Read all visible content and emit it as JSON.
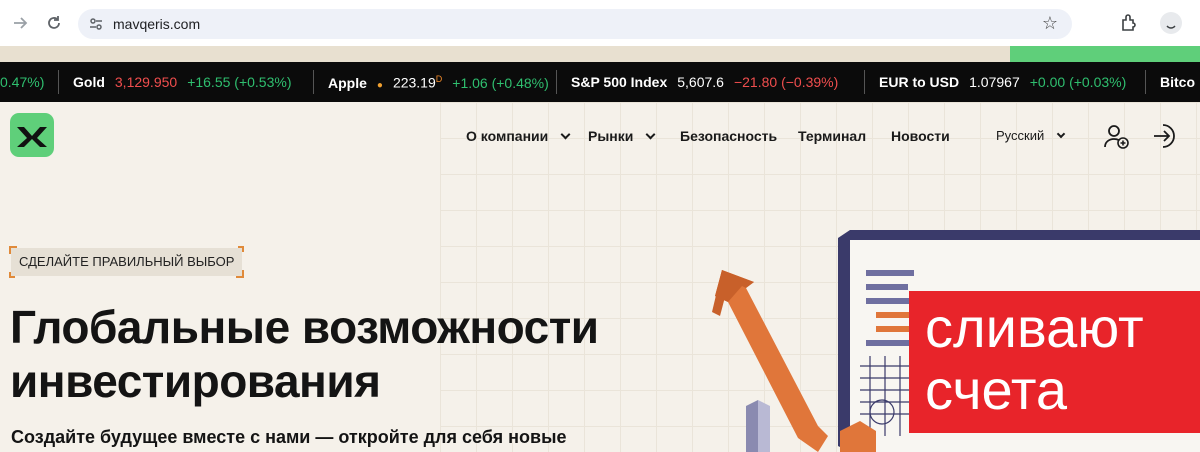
{
  "browser": {
    "url": "mavqeris.com",
    "icons": [
      "arrow-forward-icon",
      "reload-icon",
      "site-settings-icon",
      "bookmark-star-icon",
      "extensions-icon",
      "profile-icon"
    ]
  },
  "ticker": {
    "items": [
      {
        "name": "",
        "price": "",
        "change": "",
        "pct": "0.47%)",
        "dir": "pos"
      },
      {
        "name": "Gold",
        "price": "3,129.950",
        "change": "+16.55",
        "pct": "(+0.53%)",
        "dir": "pos",
        "price_color": "red"
      },
      {
        "name": "Apple",
        "price": "223.19",
        "marker": "D",
        "change": "+1.06",
        "pct": "(+0.48%)",
        "dir": "pos"
      },
      {
        "name": "S&P 500 Index",
        "price": "5,607.6",
        "change": "−21.80",
        "pct": "(−0.39%)",
        "dir": "neg"
      },
      {
        "name": "EUR to USD",
        "price": "1.07967",
        "change": "+0.00",
        "pct": "(+0.03%)",
        "dir": "pos"
      },
      {
        "name": "Bitco",
        "price": "",
        "change": "",
        "pct": "",
        "dir": "pos"
      }
    ]
  },
  "nav": {
    "items": [
      {
        "label": "О компании",
        "has_dropdown": true
      },
      {
        "label": "Рынки",
        "has_dropdown": true
      },
      {
        "label": "Безопасность",
        "has_dropdown": false
      },
      {
        "label": "Терминал",
        "has_dropdown": false
      },
      {
        "label": "Новости",
        "has_dropdown": false
      }
    ],
    "language": "Русский"
  },
  "hero": {
    "tag": "СДЕЛАЙТЕ ПРАВИЛЬНЫЙ ВЫБОР",
    "headline_line1": "Глобальные возможности",
    "headline_line2": "инвестирования",
    "subline": "Создайте будущее вместе с нами — откройте для себя новые"
  },
  "overlay": {
    "line1": "сливают",
    "line2": "счета"
  },
  "colors": {
    "brand_green": "#5fcf7a",
    "accent_orange": "#e0763a",
    "overlay_red": "#e8242a",
    "ticker_bg": "#0b0b0b",
    "positive": "#2fbf6f",
    "negative": "#f04e4e"
  }
}
